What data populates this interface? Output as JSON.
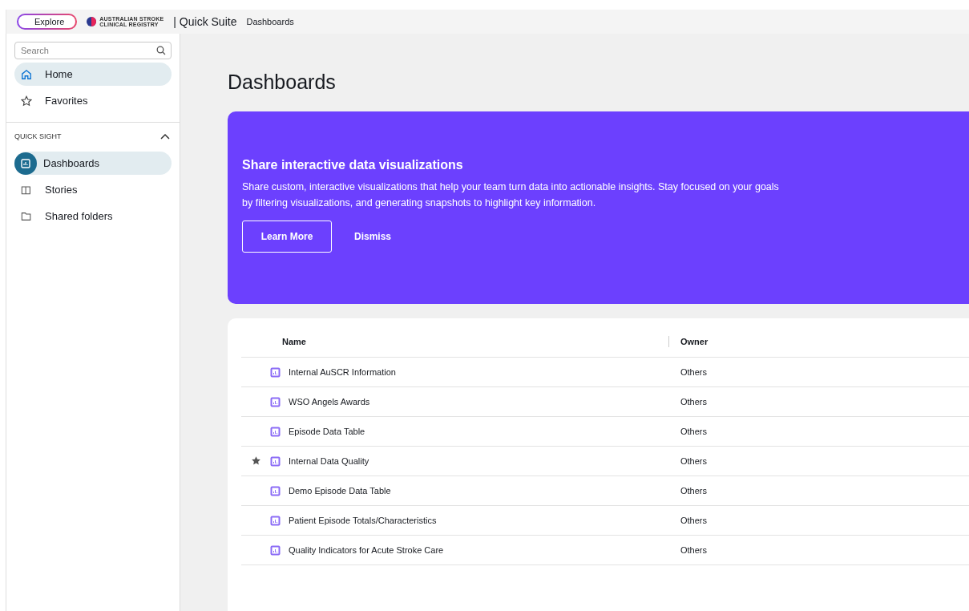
{
  "header": {
    "explore_button": "Explore",
    "logo_text": [
      "AUSTRALIAN STROKE",
      "CLINICAL REGISTRY"
    ],
    "app_name": "| Quick Suite",
    "breadcrumb": "Dashboards"
  },
  "sidebar": {
    "search": {
      "placeholder": "Search"
    },
    "top_items": [
      {
        "label": "Home",
        "selected": true
      },
      {
        "label": "Favorites",
        "selected": false
      }
    ],
    "section": {
      "title": "QUICK SIGHT",
      "expanded": true
    },
    "items": [
      {
        "label": "Dashboards",
        "selected": true
      },
      {
        "label": "Stories",
        "selected": false
      },
      {
        "label": "Shared folders",
        "selected": false
      }
    ]
  },
  "page_title": "Dashboards",
  "banner": {
    "title": "Share interactive data visualizations",
    "text": "Share custom, interactive visualizations that help your team turn data into actionable insights. Stay focused on your goals by filtering visualizations, and generating snapshots to highlight key information.",
    "buttons": [
      {
        "label": "Learn More",
        "kind": "outline"
      },
      {
        "label": "Dismiss",
        "kind": "text"
      }
    ]
  },
  "table": {
    "columns": [
      "Name",
      "Owner"
    ],
    "rows": [
      {
        "name": "Internal AuSCR Information",
        "owner": "Others",
        "favorite": false
      },
      {
        "name": "WSO Angels Awards",
        "owner": "Others",
        "favorite": false
      },
      {
        "name": "Episode Data Table",
        "owner": "Others",
        "favorite": false
      },
      {
        "name": "Internal Data Quality",
        "owner": "Others",
        "favorite": true
      },
      {
        "name": "Demo Episode Data Table",
        "owner": "Others",
        "favorite": false
      },
      {
        "name": "Patient Episode Totals/Characteristics",
        "owner": "Others",
        "favorite": false
      },
      {
        "name": "Quality Indicators for Acute Stroke Care",
        "owner": "Others",
        "favorite": false
      }
    ]
  }
}
